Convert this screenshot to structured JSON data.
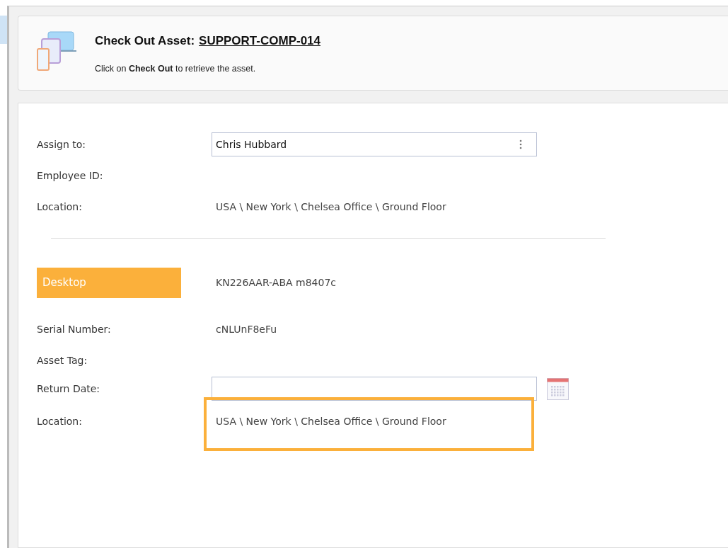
{
  "header": {
    "title": "Check Out Asset:",
    "asset_link": "SUPPORT-COMP-014",
    "instruction": "Click on **Check Out** to retrieve the asset."
  },
  "assignee": [
    {
      "kind": "select",
      "label": "Assign to:",
      "value": "Chris Hubbard"
    },
    {
      "kind": "text",
      "label": "Employee ID:"
    },
    {
      "kind": "text",
      "label": "Location:",
      "value": "USA \\ New York \\ Chelsea Office \\ Ground Floor"
    }
  ],
  "asset": {
    "type_badge": "Desktop",
    "model": "KN226AAR-ABA m8407c",
    "fields": [
      {
        "kind": "text",
        "label": "Serial Number:",
        "value": "cNLUnF8eFu"
      },
      {
        "kind": "text",
        "label": "Asset Tag:"
      },
      {
        "kind": "date",
        "label": "Return Date:"
      },
      {
        "kind": "text",
        "label": "Location:",
        "value": "USA \\ New York \\ Chelsea Office \\ Ground Floor",
        "highlighted": true
      }
    ]
  }
}
